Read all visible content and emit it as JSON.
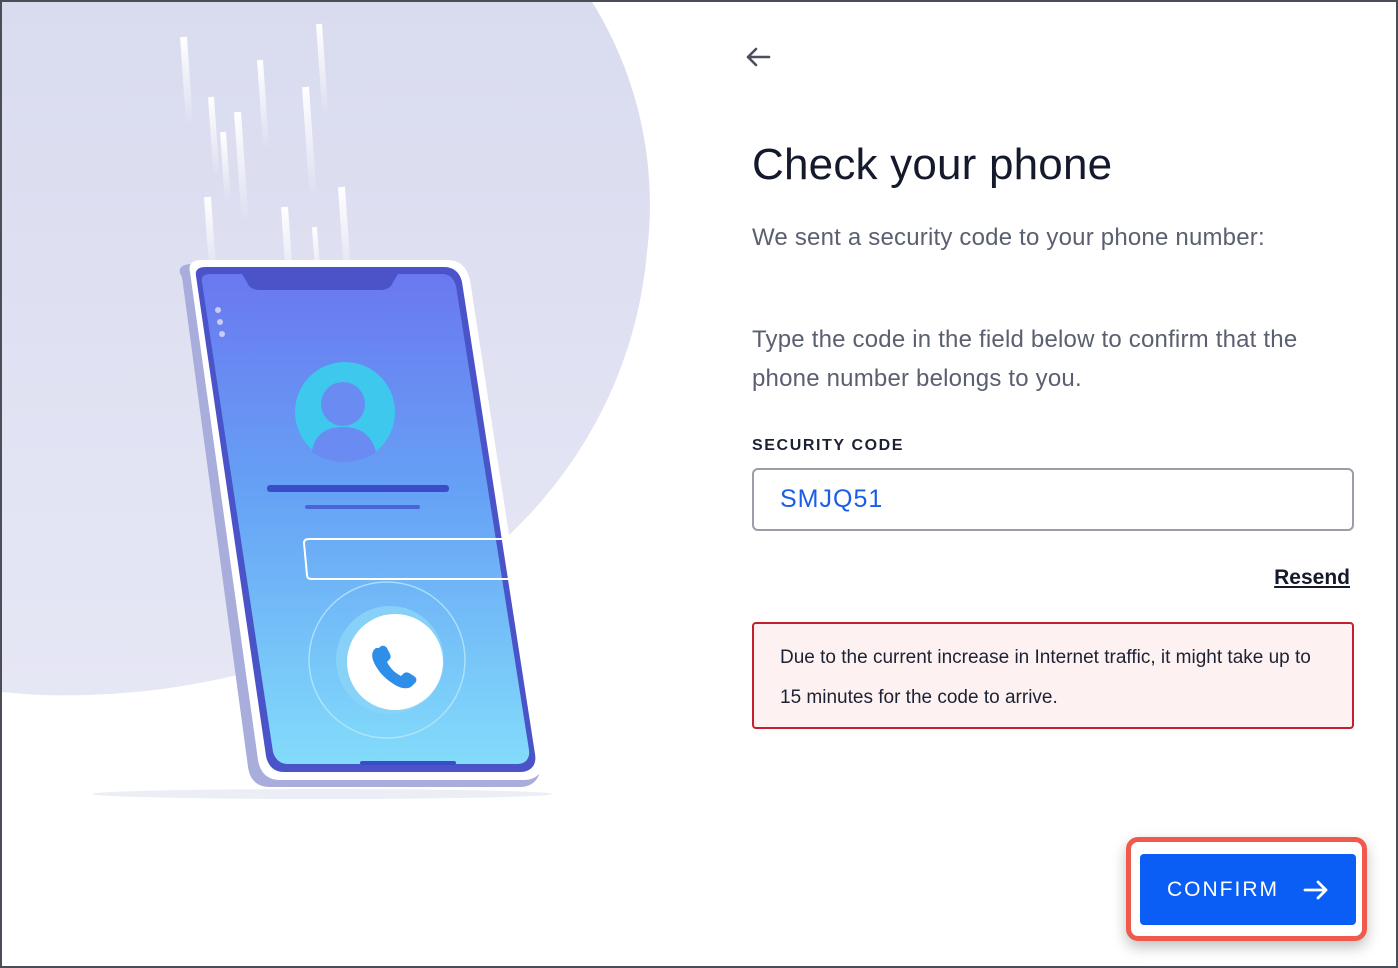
{
  "header": {
    "back_icon": "arrow-left-icon"
  },
  "main": {
    "title": "Check your phone",
    "subtitle": "We sent a security code to your phone number:",
    "instruction": "Type the code in the field below to confirm that the phone number belongs to you.",
    "field": {
      "label": "SECURITY CODE",
      "value": "SMJQ51"
    },
    "resend_label": "Resend",
    "alert": {
      "text": "Due to the current increase in Internet traffic, it might take up to 15 minutes for the code to arrive.",
      "border_color": "#c41f2e",
      "background_color": "#fdf2f1"
    }
  },
  "footer": {
    "confirm_label": "CONFIRM",
    "confirm_icon": "arrow-right-icon",
    "confirm_color": "#0a5ef6",
    "highlight_color": "#ef5a4c"
  },
  "illustration": {
    "description_icon": "phone-call-illustration"
  }
}
